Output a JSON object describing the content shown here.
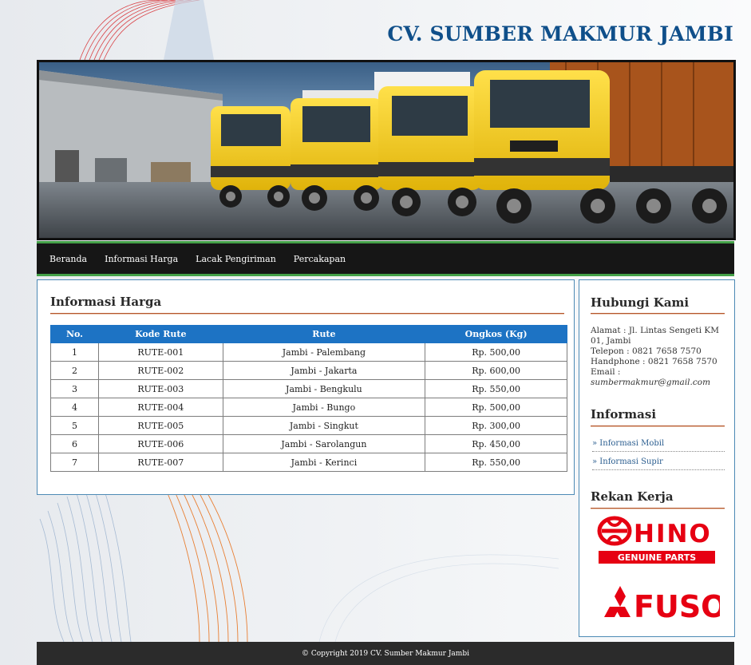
{
  "site": {
    "title": "CV. SUMBER MAKMUR JAMBI"
  },
  "nav": {
    "items": [
      {
        "label": "Beranda"
      },
      {
        "label": "Informasi Harga"
      },
      {
        "label": "Lacak Pengiriman"
      },
      {
        "label": "Percakapan"
      }
    ]
  },
  "main": {
    "heading": "Informasi Harga",
    "table": {
      "headers": [
        "No.",
        "Kode Rute",
        "Rute",
        "Ongkos (Kg)"
      ],
      "rows": [
        [
          "1",
          "RUTE-001",
          "Jambi - Palembang",
          "Rp. 500,00"
        ],
        [
          "2",
          "RUTE-002",
          "Jambi - Jakarta",
          "Rp. 600,00"
        ],
        [
          "3",
          "RUTE-003",
          "Jambi - Bengkulu",
          "Rp. 550,00"
        ],
        [
          "4",
          "RUTE-004",
          "Jambi - Bungo",
          "Rp. 500,00"
        ],
        [
          "5",
          "RUTE-005",
          "Jambi - Singkut",
          "Rp. 300,00"
        ],
        [
          "6",
          "RUTE-006",
          "Jambi - Sarolangun",
          "Rp. 450,00"
        ],
        [
          "7",
          "RUTE-007",
          "Jambi - Kerinci",
          "Rp. 550,00"
        ]
      ]
    }
  },
  "sidebar": {
    "contact_title": "Hubungi Kami",
    "alamat": "Alamat : Jl. Lintas Sengeti KM 01, Jambi",
    "telepon": "Telepon : 0821 7658 7570",
    "handphone": "Handphone : 0821 7658 7570",
    "email_label": "Email : ",
    "email": "sumbermakmur@gmail.com",
    "info_title": "Informasi",
    "info_links": [
      "» Informasi Mobil",
      "» Informasi Supir"
    ],
    "partner_title": "Rekan Kerja",
    "hino_logo_text": "HINO",
    "hino_sub_text": "GENUINE PARTS",
    "fuso_logo_text": "FUSO"
  },
  "footer": {
    "text": "© Copyright 2019 CV. Sumber Makmur Jambi"
  },
  "colors": {
    "title": "#0f4f8a",
    "nav_bg": "#161616",
    "nav_border": "#43a047",
    "table_header": "#1d73c4",
    "hino_red": "#e60012",
    "fuso_red": "#e60012",
    "truck_yellow": "#f6cf14"
  }
}
